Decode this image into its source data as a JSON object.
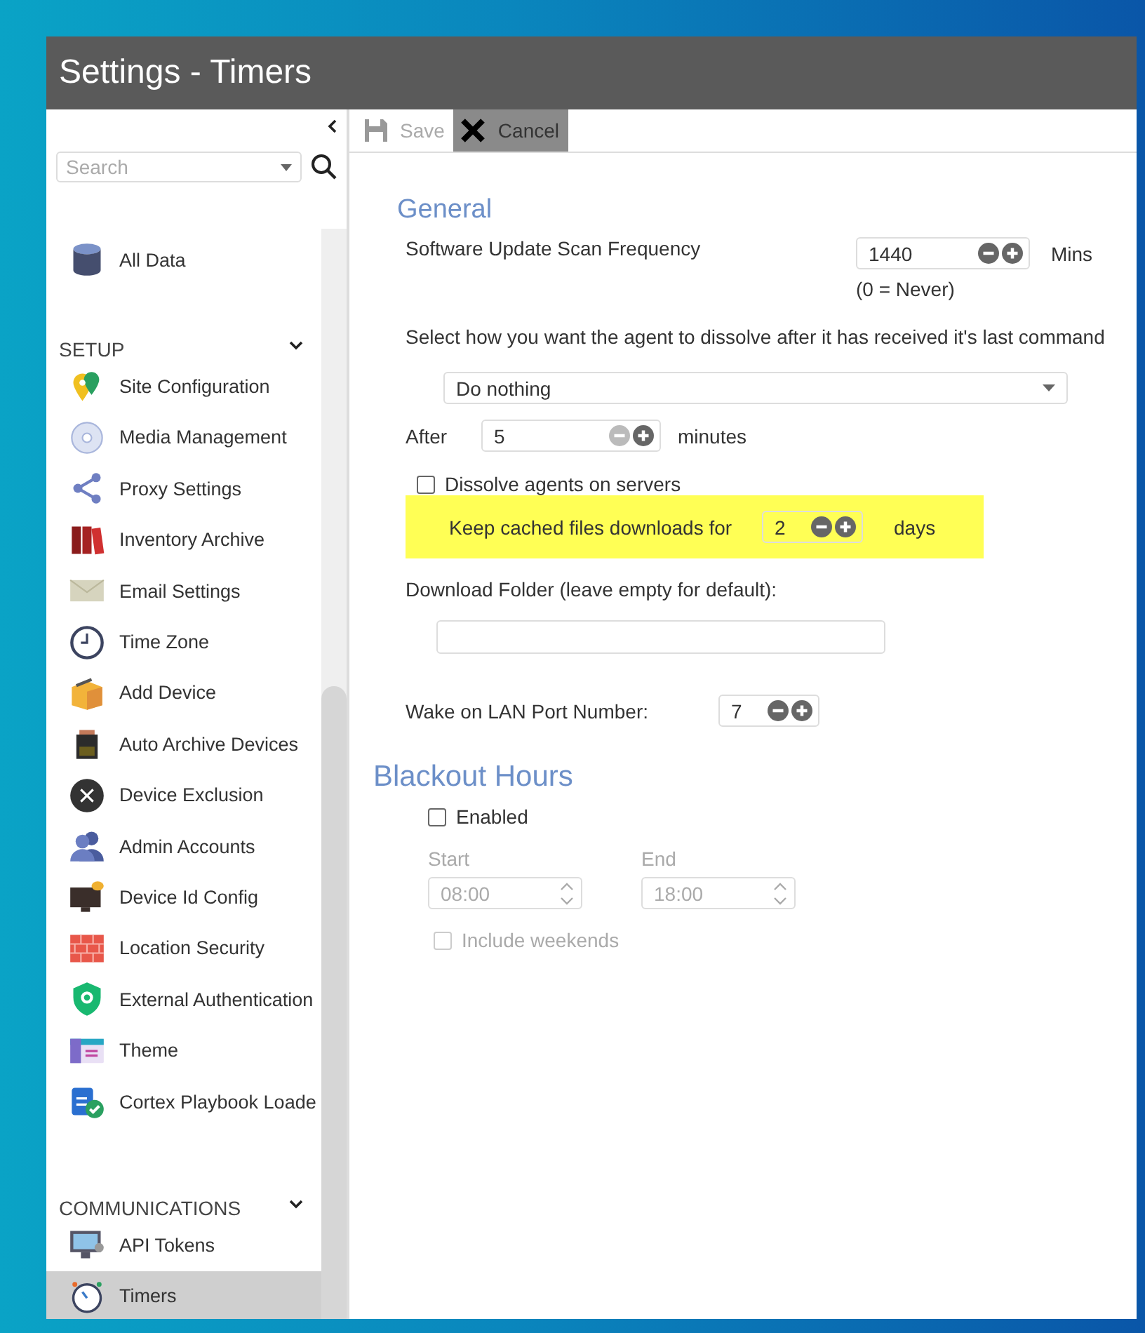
{
  "window": {
    "title": "Settings - Timers"
  },
  "sidebar": {
    "search": {
      "placeholder": "Search"
    },
    "top_items": [
      {
        "label": "All Data",
        "selected": false
      }
    ],
    "groups": [
      {
        "title": "SETUP",
        "expanded": true,
        "items": [
          {
            "label": "Site Configuration",
            "selected": false
          },
          {
            "label": "Media Management",
            "selected": false
          },
          {
            "label": "Proxy Settings",
            "selected": false
          },
          {
            "label": "Inventory Archive",
            "selected": false
          },
          {
            "label": "Email Settings",
            "selected": false
          },
          {
            "label": "Time Zone",
            "selected": false
          },
          {
            "label": "Add Device",
            "selected": false
          },
          {
            "label": "Auto Archive Devices",
            "selected": false
          },
          {
            "label": "Device Exclusion",
            "selected": false
          },
          {
            "label": "Admin Accounts",
            "selected": false
          },
          {
            "label": "Device Id Config",
            "selected": false
          },
          {
            "label": "Location Security",
            "selected": false
          },
          {
            "label": "External Authentication",
            "selected": false
          },
          {
            "label": "Theme",
            "selected": false
          },
          {
            "label": "Cortex Playbook Loade",
            "selected": false
          }
        ]
      },
      {
        "title": "COMMUNICATIONS",
        "expanded": true,
        "items": [
          {
            "label": "API Tokens",
            "selected": false
          },
          {
            "label": "Timers",
            "selected": true
          }
        ]
      }
    ]
  },
  "toolbar": [
    {
      "kind": "save",
      "label": "Save",
      "disabled": true
    },
    {
      "kind": "cancel",
      "label": "Cancel",
      "disabled": false
    }
  ],
  "general": {
    "title": "General",
    "scan_frequency": {
      "label": "Software Update Scan Frequency",
      "value": "1440",
      "unit": "Mins",
      "note": "(0 = Never)",
      "decrement_disabled": false
    },
    "dissolve": {
      "label": "Select how you want the agent to dissolve after it has received it's last command",
      "select": "Do nothing",
      "after": {
        "label": "After",
        "value": "5",
        "unit": "minutes",
        "decrement_disabled": true
      },
      "servers": {
        "label": "Dissolve agents on servers",
        "checked": false
      }
    },
    "cache": {
      "label": "Keep cached files downloads for",
      "value": "2",
      "unit": "days",
      "highlighted": true,
      "decrement_disabled": false
    },
    "download_folder": {
      "label": "Download Folder (leave empty for default):"
    },
    "wake_on_lan": {
      "label": "Wake on LAN Port Number:",
      "value": "7",
      "decrement_disabled": false
    }
  },
  "blackout": {
    "title": "Blackout Hours",
    "enabled": {
      "label": "Enabled",
      "checked": false
    },
    "start": {
      "label": "Start",
      "value": "08:00",
      "disabled": true
    },
    "end": {
      "label": "End",
      "value": "18:00",
      "disabled": true
    },
    "weekends": {
      "label": "Include weekends",
      "checked": false,
      "disabled": true
    }
  }
}
